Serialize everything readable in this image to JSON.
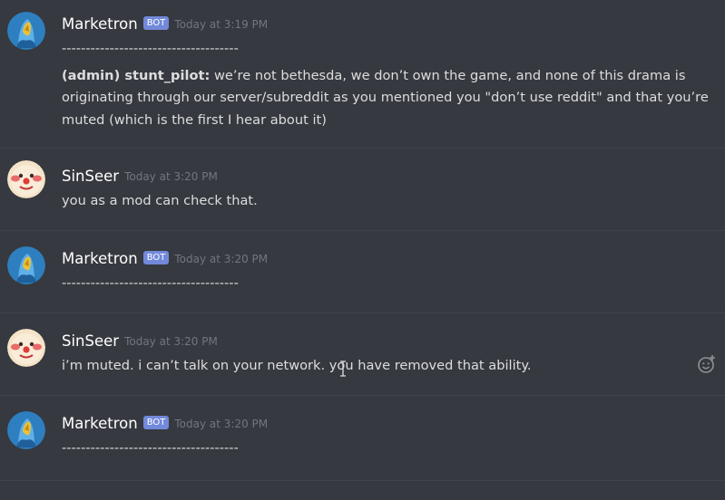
{
  "messages": [
    {
      "author": "Marketron",
      "bot_tag": "BOT",
      "timestamp": "Today at 3:19 PM",
      "lines": [
        "-------------------------------------",
        ""
      ],
      "quote_author": "(admin) stunt_pilot:",
      "quote_text": " we’re not bethesda, we don’t own the game, and none of this drama is originating through our server/subreddit as you mentioned you \"don’t use reddit\" and that you’re muted (which is the first I hear about it)"
    },
    {
      "author": "SinSeer",
      "timestamp": "Today at 3:20 PM",
      "text": "you as a mod can check that."
    },
    {
      "author": "Marketron",
      "bot_tag": "BOT",
      "timestamp": "Today at 3:20 PM",
      "text": "-------------------------------------"
    },
    {
      "author": "SinSeer",
      "timestamp": "Today at 3:20 PM",
      "text": "i’m muted. i can’t talk on your network. you have removed that ability."
    },
    {
      "author": "Marketron",
      "bot_tag": "BOT",
      "timestamp": "Today at 3:20 PM",
      "text": "-------------------------------------"
    }
  ],
  "icons": {
    "marketron_avatar": "blue-robed-figure-avatar",
    "sinseer_avatar": "clown-face-avatar",
    "add_reaction": "smiley-add-reaction-icon",
    "text_cursor": "i-beam-cursor-icon"
  },
  "colors": {
    "background": "#36393f",
    "bot_tag": "#7289da",
    "username": "#ffffff",
    "timestamp": "#72767d",
    "text": "#dcddde"
  }
}
